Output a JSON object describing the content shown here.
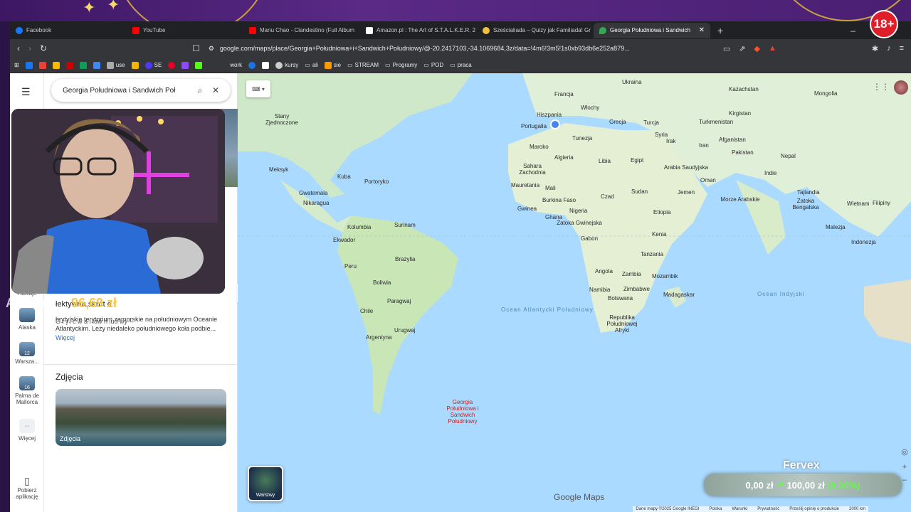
{
  "tabs": [
    {
      "label": "Facebook",
      "color": "#1877f2"
    },
    {
      "label": "YouTube",
      "color": "#ff0000"
    },
    {
      "label": "Manu Chao - Clandestino (Full Album",
      "color": "#ff0000"
    },
    {
      "label": "Amazon.pl : The Art of S.T.A.L.K.E.R. 2",
      "color": "#ffffff"
    },
    {
      "label": "Sześcialiada – Quizy jak Familiada! Gr",
      "color": "#f0c040"
    },
    {
      "label": "Georgia Południowa i Sandwich",
      "color": "#34a853"
    }
  ],
  "address_url": "google.com/maps/place/Georgia+Południowa+i+Sandwich+Południowy/@-20.2417103,-34.1069684,3z/data=!4m6!3m5!1s0xb93db6e252a879...",
  "bookmarks": [
    "use",
    "SE",
    "work",
    "kursy",
    "ali",
    "sie",
    "STREAM",
    "Programy",
    "POD",
    "praca"
  ],
  "badge18": "18+",
  "rail": {
    "items": [
      {
        "label": "Hawaje"
      },
      {
        "label": "Alaska"
      },
      {
        "label": "Warsza..."
      },
      {
        "label": "Palma de Mallorca"
      },
      {
        "label": "Więcej"
      },
      {
        "label": "Pobierz aplikację"
      }
    ]
  },
  "panel": {
    "search_value": "Georgia Południowa i Sandwich Poł",
    "info_title_partial": "łektywna skrót e",
    "info_line_partial": "G   r   j   l c  w  a  i  idw  h   lud     wy –",
    "description": "brytyjskie terytorium zamorskie na południowym Oceanie Atlantyckim. Leży niedaleko południowego koła podbie...",
    "more_link": "Więcej",
    "photos_heading": "Zdjęcia",
    "photo_caption": "Zdjęcia"
  },
  "map": {
    "labels": [
      {
        "t": "Ukraina"
      },
      {
        "t": "Kazachstan"
      },
      {
        "t": "Mongolia"
      },
      {
        "t": "Francja"
      },
      {
        "t": "Włochy"
      },
      {
        "t": "Stany Zjednoczone"
      },
      {
        "t": "Hiszpania"
      },
      {
        "t": "Portugalia"
      },
      {
        "t": "Grecja"
      },
      {
        "t": "Turcja"
      },
      {
        "t": "Turkmenistan"
      },
      {
        "t": "Kirgistan"
      },
      {
        "t": "Tunezja"
      },
      {
        "t": "Maroko"
      },
      {
        "t": "Syria"
      },
      {
        "t": "Irak"
      },
      {
        "t": "Iran"
      },
      {
        "t": "Afganistan"
      },
      {
        "t": "Pakistan"
      },
      {
        "t": "Nepal"
      },
      {
        "t": "Algieria"
      },
      {
        "t": "Libia"
      },
      {
        "t": "Egipt"
      },
      {
        "t": "Arabia Saudyjska"
      },
      {
        "t": "Indie"
      },
      {
        "t": "Meksyk"
      },
      {
        "t": "Sahara Zachodnia"
      },
      {
        "t": "Kuba"
      },
      {
        "t": "Portoryko"
      },
      {
        "t": "Gwatemala"
      },
      {
        "t": "Mauretania"
      },
      {
        "t": "Mali"
      },
      {
        "t": "Czad"
      },
      {
        "t": "Sudan"
      },
      {
        "t": "Jemen"
      },
      {
        "t": "Oman"
      },
      {
        "t": "Nikaragua"
      },
      {
        "t": "Burkina Faso"
      },
      {
        "t": "Gwinea"
      },
      {
        "t": "Nigeria"
      },
      {
        "t": "Ghana"
      },
      {
        "t": "Etiopia"
      },
      {
        "t": "Tajlandia"
      },
      {
        "t": "Wietnam"
      },
      {
        "t": "Filipiny"
      },
      {
        "t": "Zatoka Gwinejska"
      },
      {
        "t": "Morze Arabskie"
      },
      {
        "t": "Zatoka Bengalska"
      },
      {
        "t": "Surinam"
      },
      {
        "t": "Kolumbia"
      },
      {
        "t": "Gabon"
      },
      {
        "t": "Kenia"
      },
      {
        "t": "Malezja"
      },
      {
        "t": "Ekwador"
      },
      {
        "t": "Indonezja"
      },
      {
        "t": "Tanzania"
      },
      {
        "t": "Brazylia"
      },
      {
        "t": "Peru"
      },
      {
        "t": "Angola"
      },
      {
        "t": "Zambia"
      },
      {
        "t": "Boliwia"
      },
      {
        "t": "Mozambik"
      },
      {
        "t": "Namibia"
      },
      {
        "t": "Zimbabwe"
      },
      {
        "t": "Madagaskar"
      },
      {
        "t": "Paragwaj"
      },
      {
        "t": "Botswana"
      },
      {
        "t": "Chile"
      },
      {
        "t": "Urugwaj"
      },
      {
        "t": "Republika Południowej Afryki"
      },
      {
        "t": "Argentyna"
      }
    ],
    "ocean_atlantic": "Ocean Atlantycki Południowy",
    "ocean_indian": "Ocean Indyjski",
    "marker_label": "Georgia Południowa i Sandwich Południowy",
    "layers_label": "Warstwy",
    "brand": "Google Maps",
    "footer": [
      "Dane mapy ©2025 Google INEGI",
      "Polska",
      "Warunki",
      "Prywatność",
      "Prześlij opinię o produkcie",
      "2000 km"
    ]
  },
  "stream": {
    "donor_name": "Anonim",
    "donor_amount": "96,69 zł",
    "goal_title": "Fervex",
    "goal_current": "0,00 zł",
    "goal_target": "100,00 zł",
    "goal_percent": "(0.00%)",
    "goal_arrow": "⬏"
  }
}
